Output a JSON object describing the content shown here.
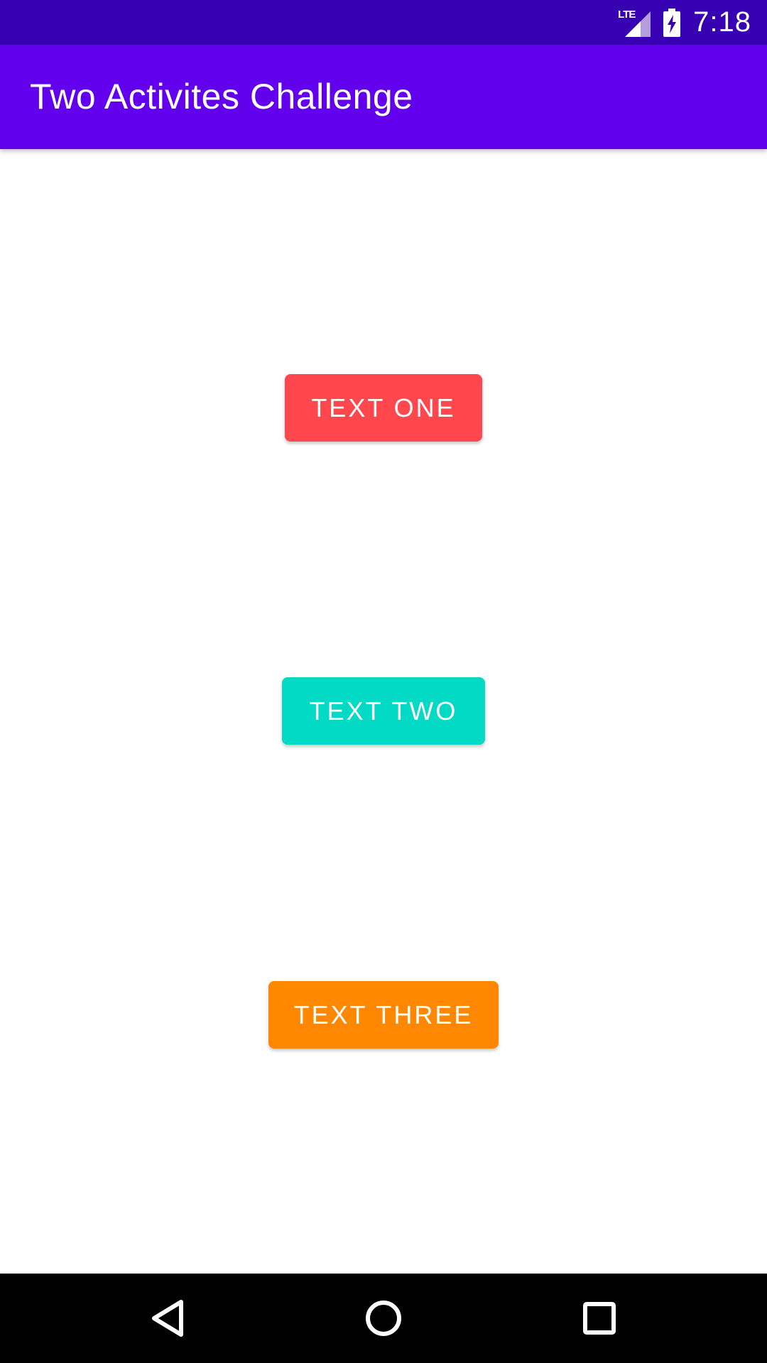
{
  "status_bar": {
    "network": "LTE",
    "time": "7:18",
    "signal_icon": "signal-icon",
    "battery_icon": "battery-charging-icon"
  },
  "app_bar": {
    "title": "Two Activites Challenge"
  },
  "buttons": [
    {
      "label": "TEXT ONE",
      "color": "#ff474d"
    },
    {
      "label": "TEXT TWO",
      "color": "#03dac5"
    },
    {
      "label": "TEXT THREE",
      "color": "#ff8800"
    }
  ],
  "nav_bar": {
    "back_icon": "back-icon",
    "home_icon": "home-icon",
    "recents_icon": "recents-icon"
  },
  "colors": {
    "status_bar": "#3700b3",
    "app_bar": "#6200ee",
    "background": "#ffffff",
    "nav_bar": "#000000"
  }
}
